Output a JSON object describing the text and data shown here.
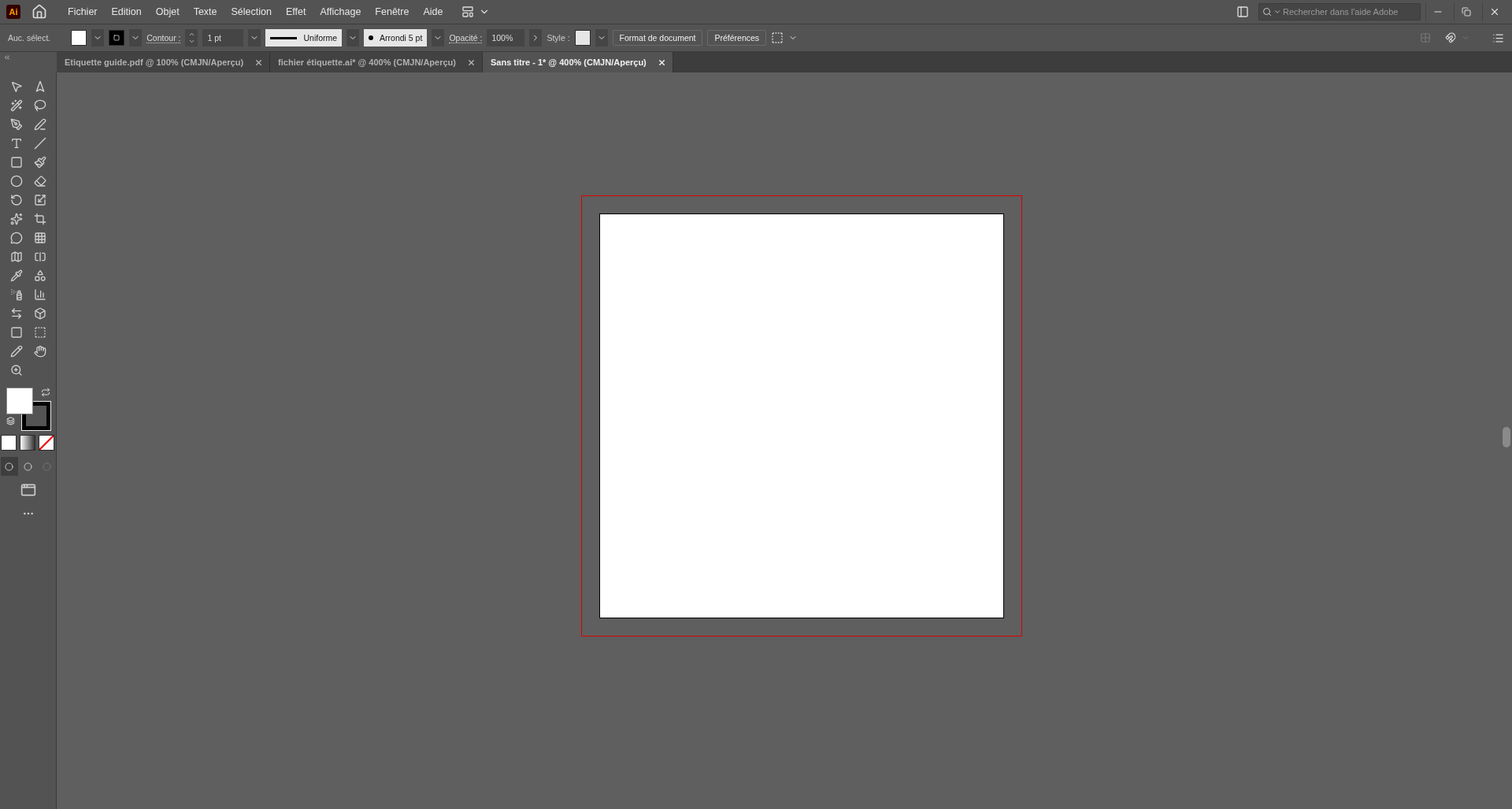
{
  "app_badge": "Ai",
  "menu": [
    "Fichier",
    "Edition",
    "Objet",
    "Texte",
    "Sélection",
    "Effet",
    "Affichage",
    "Fenêtre",
    "Aide"
  ],
  "search": {
    "placeholder": "Rechercher dans l'aide Adobe"
  },
  "control_bar": {
    "selection_label": "Auc. sélect.",
    "stroke_label": "Contour :",
    "stroke_weight": "1 pt",
    "stroke_profile": "Uniforme",
    "brush": "Arrondi 5 pt",
    "opacity_label": "Opacité :",
    "opacity": "100%",
    "style_label": "Style :",
    "buttons": [
      "Format de document",
      "Préférences"
    ]
  },
  "tabs": [
    {
      "title": "Etiquette guide.pdf @ 100% (CMJN/Aperçu)",
      "selected": false
    },
    {
      "title": "fichier étiquette.ai* @ 400% (CMJN/Aperçu)",
      "selected": false
    },
    {
      "title": "Sans titre - 1* @ 400% (CMJN/Aperçu)",
      "selected": true
    }
  ]
}
